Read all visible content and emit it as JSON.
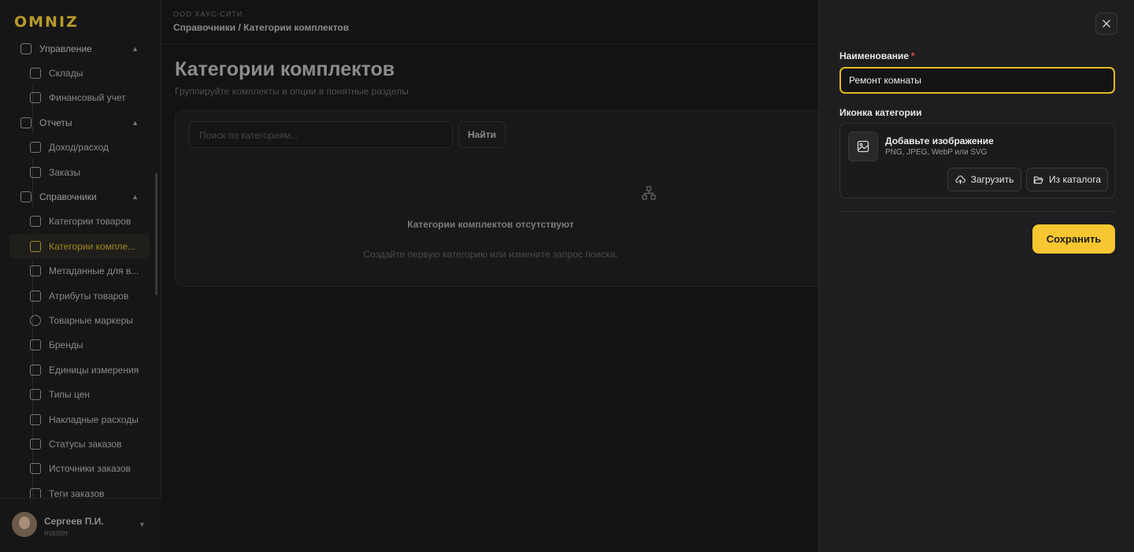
{
  "brand": {
    "logo_text": "OMNIZ",
    "accent": "#f8c630"
  },
  "sidebar": {
    "items": [
      {
        "label": "Управление",
        "icon": "layout-icon",
        "type": "group"
      },
      {
        "label": "Склады",
        "icon": "folder-icon",
        "type": "sub"
      },
      {
        "label": "Финансовый учет",
        "icon": "wallet-icon",
        "type": "sub"
      },
      {
        "label": "Отчеты",
        "icon": "bar-chart-icon",
        "type": "group"
      },
      {
        "label": "Доход/расход",
        "icon": "bank-icon",
        "type": "sub"
      },
      {
        "label": "Заказы",
        "icon": "box-icon",
        "type": "sub"
      },
      {
        "label": "Справочники",
        "icon": "book-icon",
        "type": "group"
      },
      {
        "label": "Категории товаров",
        "icon": "tree-icon",
        "type": "sub"
      },
      {
        "label": "Категории компле...",
        "icon": "shapes-icon",
        "type": "sub",
        "active": true
      },
      {
        "label": "Метаданные для в...",
        "icon": "list-icon",
        "type": "sub"
      },
      {
        "label": "Атрибуты товаров",
        "icon": "document-icon",
        "type": "sub"
      },
      {
        "label": "Товарные маркеры",
        "icon": "circle-icon",
        "type": "sub"
      },
      {
        "label": "Бренды",
        "icon": "bookmark-icon",
        "type": "sub"
      },
      {
        "label": "Единицы измерения",
        "icon": "ruler-icon",
        "type": "sub"
      },
      {
        "label": "Типы цен",
        "icon": "price-tag-icon",
        "type": "sub"
      },
      {
        "label": "Накладные расходы",
        "icon": "invoice-icon",
        "type": "sub"
      },
      {
        "label": "Статусы заказов",
        "icon": "route-icon",
        "type": "sub"
      },
      {
        "label": "Источники заказов",
        "icon": "signpost-icon",
        "type": "sub"
      },
      {
        "label": "Теги заказов",
        "icon": "tag-icon",
        "type": "sub"
      }
    ],
    "user": {
      "name": "Сергеев П.И.",
      "role": "master"
    }
  },
  "header": {
    "company": "ООО ХАУС-СИТИ",
    "breadcrumb": "Справочники / Категории комплектов"
  },
  "page": {
    "title": "Категории комплектов",
    "subtitle": "Группируйте комплекты и опции в понятные разделы",
    "search_placeholder": "Поиск по категориям...",
    "find_label": "Найти",
    "empty_title": "Категории комплектов отсутствуют",
    "empty_subtitle": "Создайте первую категорию или измените запрос поиска."
  },
  "drawer": {
    "close_icon": "close-icon",
    "name_label": "Наименование",
    "required_mark": "*",
    "name_value": "Ремонт комнаты",
    "icon_label": "Иконка категории",
    "add_image_title": "Добавьте изображение",
    "add_image_hint": "PNG, JPEG, WebP или SVG",
    "upload_label": "Загрузить",
    "catalog_label": "Из каталога",
    "save_label": "Сохранить"
  }
}
